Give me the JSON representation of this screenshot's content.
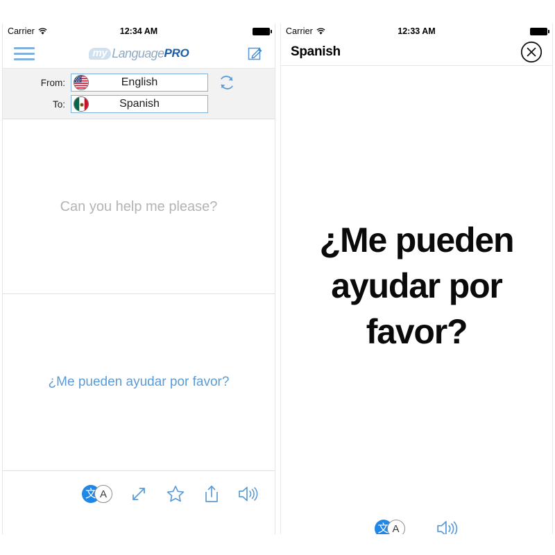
{
  "colors": {
    "accent_blue": "#7fb0de",
    "translation_blue": "#5b9bd5",
    "logo_pro_blue": "#1b5ea8",
    "logo_language_gray": "#8fa9c0",
    "placeholder_gray": "#b3b3b3",
    "translate_icon_blue": "#1f87e8",
    "lang_area_bg": "#f2f2f2"
  },
  "left_panel": {
    "status_bar": {
      "carrier": "Carrier",
      "wifi_icon": "wifi-icon",
      "time": "12:34 AM",
      "battery_icon": "battery-full-icon"
    },
    "nav": {
      "menu_icon": "hamburger-menu-icon",
      "logo": {
        "my": "my",
        "language": "Language",
        "pro": "PRO"
      },
      "compose_icon": "compose-pencil-icon"
    },
    "language_selector": {
      "from_label": "From:",
      "from_language": "English",
      "from_flag": "flag-usa-icon",
      "to_label": "To:",
      "to_language": "Spanish",
      "to_flag": "flag-mexico-icon",
      "swap_icon": "swap-refresh-icon"
    },
    "source_text": "Can you help me please?",
    "translated_text": "¿Me pueden ayudar por favor?",
    "toolbar": [
      {
        "name": "translate-toggle-icon",
        "glyph": "文",
        "secondary_glyph": "A"
      },
      {
        "name": "fullscreen-expand-icon",
        "glyph": "expand-arrows"
      },
      {
        "name": "favorite-star-icon",
        "glyph": "star"
      },
      {
        "name": "share-icon",
        "glyph": "share-up-arrow"
      },
      {
        "name": "speaker-icon",
        "glyph": "speaker-waves"
      }
    ]
  },
  "right_panel": {
    "status_bar": {
      "carrier": "Carrier",
      "wifi_icon": "wifi-icon",
      "time": "12:33 AM",
      "battery_icon": "battery-full-icon"
    },
    "nav": {
      "title": "Spanish",
      "close_icon": "close-circle-icon"
    },
    "display_text": "¿Me pueden ayudar por favor?",
    "toolbar": [
      {
        "name": "translate-toggle-icon",
        "glyph": "文",
        "secondary_glyph": "A"
      },
      {
        "name": "speaker-icon",
        "glyph": "speaker-waves"
      }
    ]
  }
}
